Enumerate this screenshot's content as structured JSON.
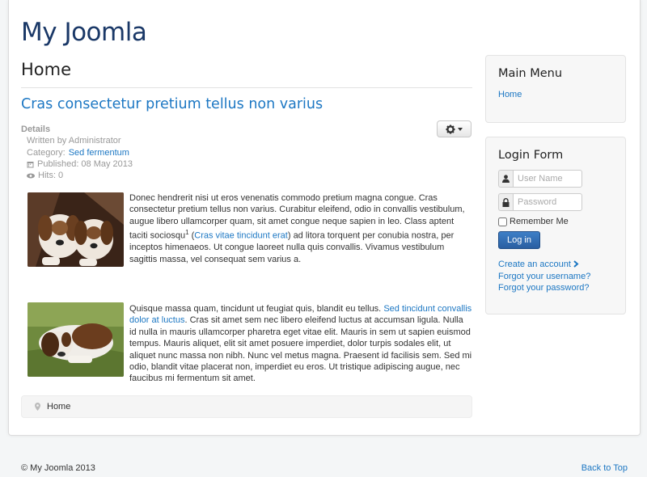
{
  "site": {
    "title": "My Joomla"
  },
  "main": {
    "page_heading": "Home",
    "article": {
      "title": "Cras consectetur pretium tellus non varius",
      "details": {
        "label": "Details",
        "written_by": "Written by Administrator",
        "category_label": "Category:",
        "category_value": "Sed fermentum",
        "published": "Published: 08 May 2013",
        "hits": "Hits: 0"
      },
      "para1": {
        "text1": "Donec hendrerit nisi ut eros venenatis commodo pretium magna congue. Cras consectetur pretium tellus non varius. Curabitur eleifend, odio in convallis vestibulum, augue libero ullamcorper quam, sit amet congue neque sapien in leo. Class aptent taciti sociosqu",
        "sup": "1",
        "link": "Cras vitae tincidunt erat",
        "text2": ") ad litora torquent per conubia nostra, per inceptos himenaeos. Ut congue laoreet nulla quis convallis. Vivamus vestibulum sagittis massa, vel consequat sem varius a."
      },
      "para2": {
        "text1": "Quisque massa quam, tincidunt ut feugiat quis, blandit eu tellus.",
        "link": "Sed tincidunt convallis dolor at luctus",
        "text2": ". Cras sit amet sem nec libero eleifend luctus at accumsan ligula. Nulla id nulla in mauris ullamcorper pharetra eget vitae elit. Mauris in sem ut sapien euismod tempus. Mauris aliquet, elit sit amet posuere imperdiet, dolor turpis sodales elit, ut aliquet nunc massa non nibh. Nunc vel metus magna. Praesent id facilisis sem. Sed mi odio, blandit vitae placerat non, imperdiet eu eros. Ut tristique adipiscing augue, nec faucibus mi fermentum sit amet."
      }
    },
    "breadcrumb": {
      "home": "Home"
    }
  },
  "sidebar": {
    "main_menu": {
      "title": "Main Menu",
      "items": [
        "Home"
      ]
    },
    "login": {
      "title": "Login Form",
      "username_placeholder": "User Name",
      "password_placeholder": "Password",
      "remember_label": "Remember Me",
      "login_button": "Log in",
      "create_account": "Create an account",
      "forgot_username": "Forgot your username?",
      "forgot_password": "Forgot your password?"
    }
  },
  "footer": {
    "copyright": "© My Joomla 2013",
    "back_to_top": "Back to Top"
  },
  "colors": {
    "title": "#1a3867",
    "link": "#1c77c3",
    "button": "#2a5fa1"
  }
}
